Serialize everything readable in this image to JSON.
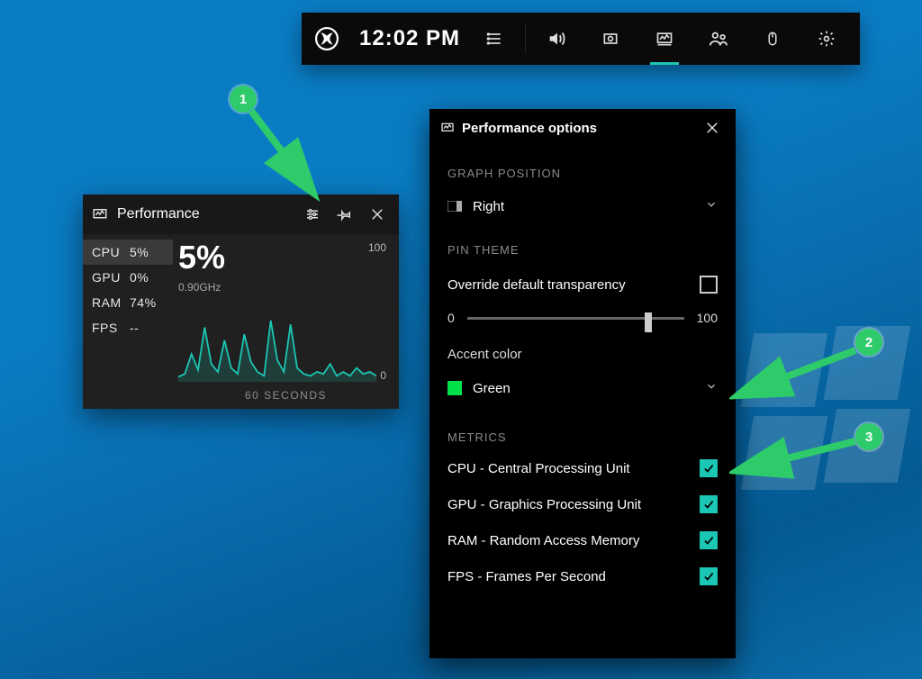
{
  "gamebar": {
    "time": "12:02 PM",
    "icons": [
      "list-icon",
      "volume-icon",
      "capture-icon",
      "performance-icon",
      "social-icon",
      "mouse-icon",
      "settings-icon"
    ],
    "active_index": 3
  },
  "perf_widget": {
    "title": "Performance",
    "metrics": [
      {
        "label": "CPU",
        "value": "5%",
        "selected": true
      },
      {
        "label": "GPU",
        "value": "0%",
        "selected": false
      },
      {
        "label": "RAM",
        "value": "74%",
        "selected": false
      },
      {
        "label": "FPS",
        "value": "--",
        "selected": false
      }
    ],
    "big_value": "5%",
    "subtitle": "0.90GHz",
    "y_max": "100",
    "y_min": "0",
    "x_label": "60 SECONDS"
  },
  "options": {
    "title": "Performance options",
    "graph_position_header": "GRAPH POSITION",
    "graph_position_value": "Right",
    "pin_theme_header": "PIN THEME",
    "override_label": "Override default transparency",
    "override_checked": false,
    "slider_min": "0",
    "slider_max": "100",
    "slider_value": 82,
    "accent_header": "Accent color",
    "accent_value": "Green",
    "accent_color": "#00e049",
    "metrics_header": "METRICS",
    "metrics": [
      {
        "label": "CPU - Central Processing Unit",
        "checked": true
      },
      {
        "label": "GPU - Graphics Processing Unit",
        "checked": true
      },
      {
        "label": "RAM - Random Access Memory",
        "checked": true
      },
      {
        "label": "FPS - Frames Per Second",
        "checked": true
      }
    ]
  },
  "annotations": {
    "n1": "1",
    "n2": "2",
    "n3": "3"
  },
  "chart_data": {
    "type": "line",
    "title": "CPU Usage",
    "xlabel": "60 SECONDS",
    "ylabel": "%",
    "ylim": [
      0,
      100
    ],
    "x": [
      0,
      2,
      4,
      6,
      8,
      10,
      12,
      14,
      16,
      18,
      20,
      22,
      24,
      26,
      28,
      30,
      32,
      34,
      36,
      38,
      40,
      42,
      44,
      46,
      48,
      50,
      52,
      54,
      56,
      58,
      60
    ],
    "values": [
      5,
      8,
      28,
      12,
      55,
      18,
      10,
      42,
      14,
      8,
      48,
      20,
      10,
      6,
      62,
      22,
      10,
      58,
      14,
      8,
      6,
      10,
      8,
      18,
      6,
      10,
      6,
      14,
      8,
      10,
      6
    ],
    "color": "#1bc6b4"
  }
}
